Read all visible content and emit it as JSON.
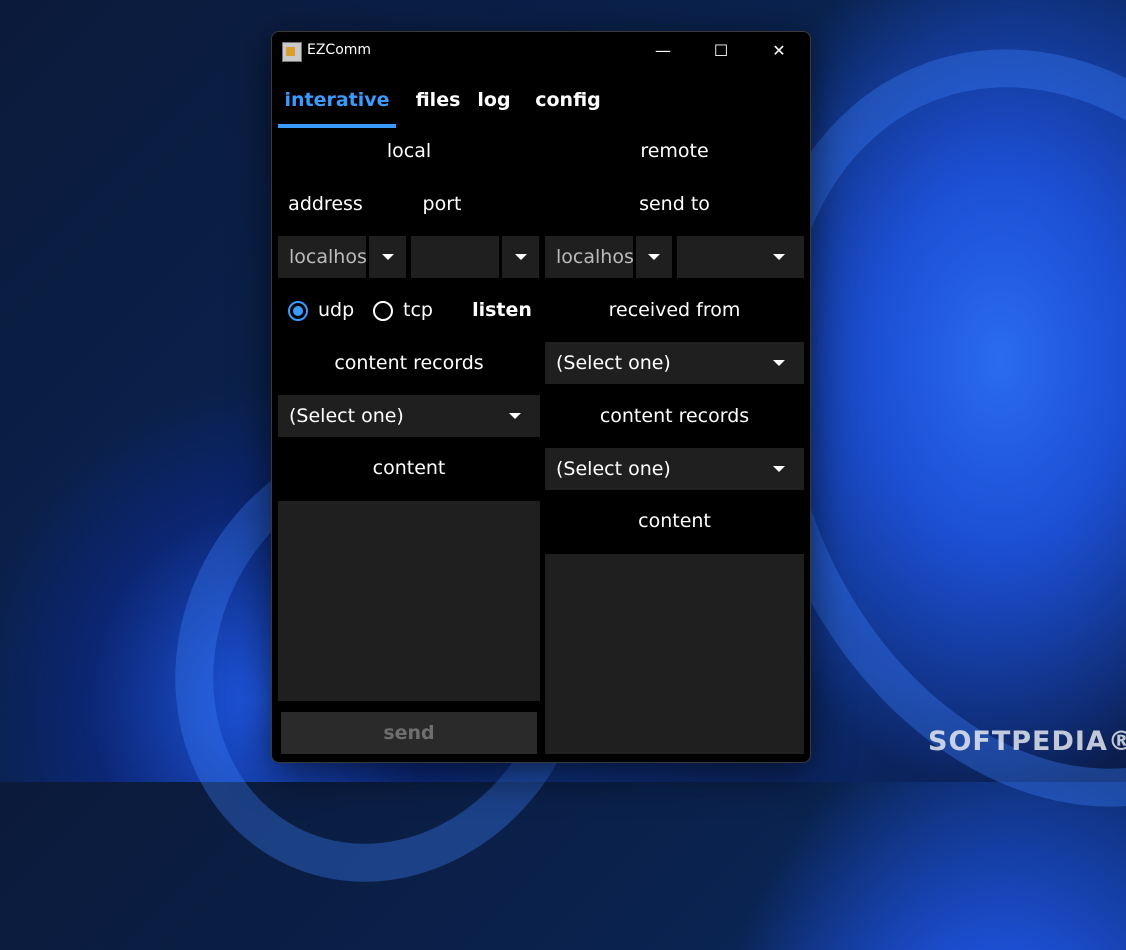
{
  "window": {
    "title": "EZComm",
    "minimize": "—",
    "maximize": "☐",
    "close": "✕"
  },
  "tabs": [
    "interative",
    "files",
    "log",
    "config"
  ],
  "local": {
    "heading": "local",
    "address_label": "address",
    "port_label": "port",
    "address_value": "localhost",
    "port_value": "",
    "protocol_udp": "udp",
    "protocol_tcp": "tcp",
    "selected_protocol": "udp",
    "listen_label": "listen",
    "content_records_label": "content records",
    "content_records_value": "(Select one)",
    "content_label": "content",
    "content_value": "",
    "send_label": "send"
  },
  "remote": {
    "heading": "remote",
    "send_to_label": "send to",
    "address_value": "localhost",
    "port_value": "",
    "received_from_label": "received from",
    "received_from_value": "(Select one)",
    "content_records_label": "content records",
    "content_records_value": "(Select one)",
    "content_label": "content",
    "content_value": ""
  },
  "watermark": "SOFTPEDIA®",
  "colors": {
    "accent": "#3a9bff",
    "window_bg": "#000000",
    "control_bg": "#1f1f1f"
  }
}
